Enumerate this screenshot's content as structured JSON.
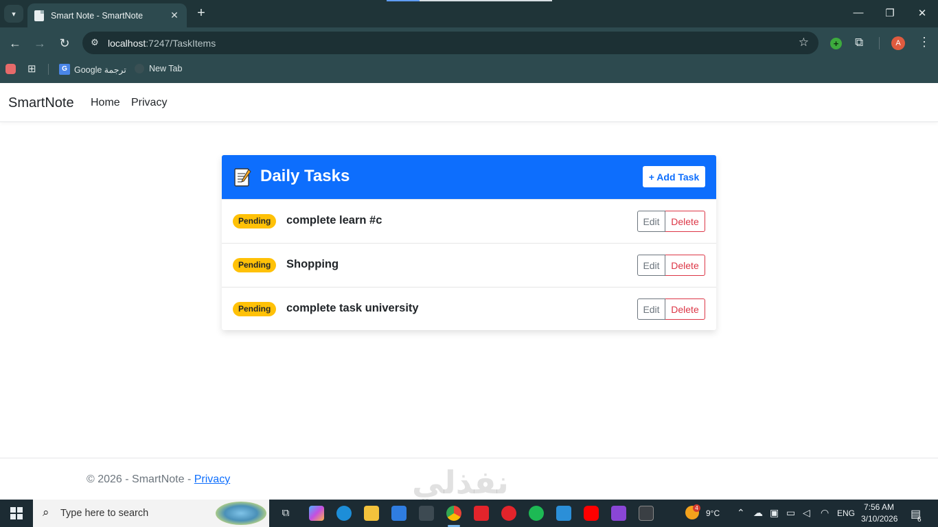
{
  "browser": {
    "tab_title": "Smart Note - SmartNote",
    "tab_close": "✕",
    "new_tab": "+",
    "url_host": "localhost",
    "url_path": ":7247/TaskItems",
    "window_controls": {
      "minimize": "—",
      "restore": "❐",
      "close": "✕"
    },
    "bookmarks": [
      {
        "label": "Google ترجمة"
      },
      {
        "label": "New Tab"
      }
    ],
    "profile_initial": "A"
  },
  "app": {
    "brand": "SmartNote",
    "nav": {
      "home": "Home",
      "privacy": "Privacy"
    }
  },
  "card": {
    "title": "Daily Tasks",
    "add_button": "+ Add Task",
    "edit_label": "Edit",
    "delete_label": "Delete",
    "tasks": [
      {
        "status": "Pending",
        "title": "complete learn #c"
      },
      {
        "status": "Pending",
        "title": "Shopping"
      },
      {
        "status": "Pending",
        "title": "complete task university"
      }
    ]
  },
  "footer": {
    "text": "© 2026 - SmartNote - ",
    "privacy_link": "Privacy"
  },
  "watermark": "نفذلي",
  "taskbar": {
    "search_placeholder": "Type here to search",
    "weather_badge": "4",
    "temperature": "9°C",
    "language": "ENG",
    "time": "7:56 AM",
    "date": "3/10/2026",
    "notifications": "6"
  },
  "colors": {
    "primary": "#0d6efd",
    "warning": "#ffc107",
    "danger": "#dc3545",
    "secondary": "#6c757d",
    "chrome": "#2d4a4f"
  }
}
